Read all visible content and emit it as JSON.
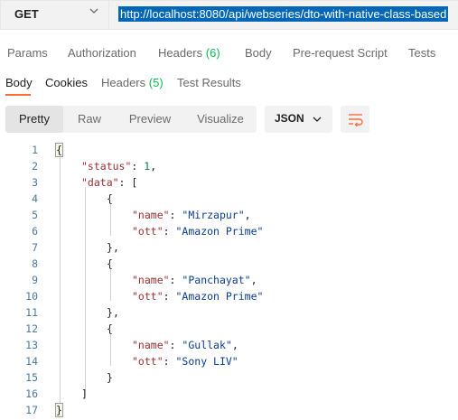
{
  "request": {
    "method": "GET",
    "url": "http://localhost:8080/api/webseries/dto-with-native-class-based"
  },
  "request_tabs": [
    {
      "label": "Params"
    },
    {
      "label": "Authorization"
    },
    {
      "label": "Headers",
      "count": "(6)"
    },
    {
      "label": "Body"
    },
    {
      "label": "Pre-request Script"
    },
    {
      "label": "Tests"
    }
  ],
  "response_tabs": [
    {
      "label": "Body"
    },
    {
      "label": "Cookies"
    },
    {
      "label": "Headers",
      "count": "(5)"
    },
    {
      "label": "Test Results"
    }
  ],
  "view_modes": [
    "Pretty",
    "Raw",
    "Preview",
    "Visualize"
  ],
  "format": "JSON",
  "accent_color": "#ff6c37",
  "count_color": "#0cbb52",
  "code_lines": [
    {
      "n": "1",
      "text": "{"
    },
    {
      "n": "2",
      "text": "\"status\": 1,"
    },
    {
      "n": "3",
      "text": "\"data\": ["
    },
    {
      "n": "4",
      "text": "{"
    },
    {
      "n": "5",
      "text": "\"name\": \"Mirzapur\","
    },
    {
      "n": "6",
      "text": "\"ott\": \"Amazon Prime\""
    },
    {
      "n": "7",
      "text": "},"
    },
    {
      "n": "8",
      "text": "{"
    },
    {
      "n": "9",
      "text": "\"name\": \"Panchayat\","
    },
    {
      "n": "10",
      "text": "\"ott\": \"Amazon Prime\""
    },
    {
      "n": "11",
      "text": "},"
    },
    {
      "n": "12",
      "text": "{"
    },
    {
      "n": "13",
      "text": "\"name\": \"Gullak\","
    },
    {
      "n": "14",
      "text": "\"ott\": \"Sony LIV\""
    },
    {
      "n": "15",
      "text": "}"
    },
    {
      "n": "16",
      "text": "]"
    },
    {
      "n": "17",
      "text": "}"
    }
  ]
}
